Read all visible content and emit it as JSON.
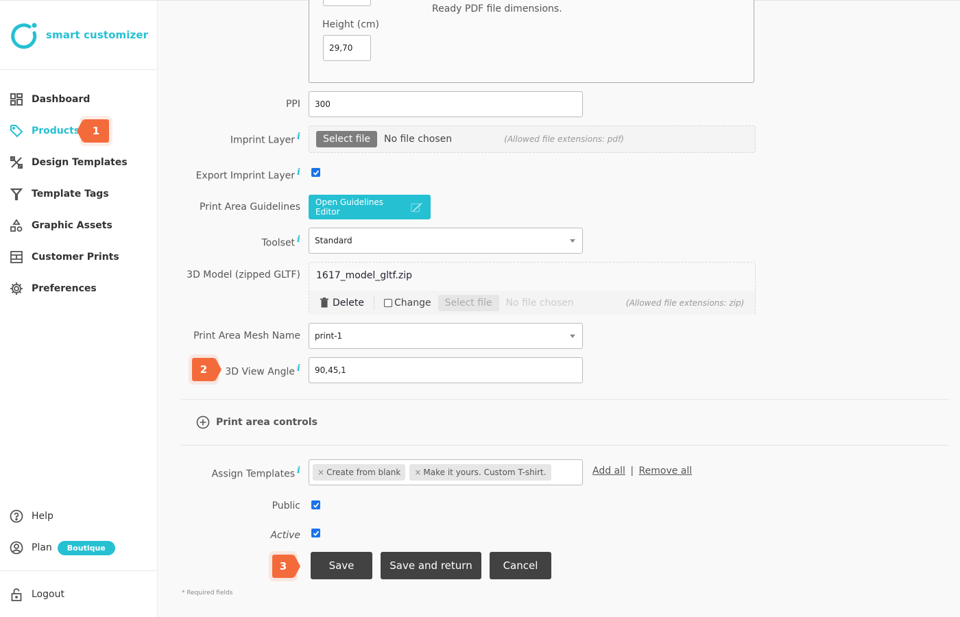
{
  "brand": {
    "name": "smart customizer",
    "accent": "#26c0d3",
    "step_badge_color": "#f46b3b"
  },
  "sidebar": {
    "items": [
      {
        "label": "Dashboard",
        "icon": "dashboard-icon",
        "active": false
      },
      {
        "label": "Products",
        "icon": "tag-icon",
        "active": true,
        "step": "1"
      },
      {
        "label": "Design Templates",
        "icon": "design-tools-icon",
        "active": false
      },
      {
        "label": "Template Tags",
        "icon": "filter-icon",
        "active": false
      },
      {
        "label": "Graphic Assets",
        "icon": "shapes-icon",
        "active": false
      },
      {
        "label": "Customer Prints",
        "icon": "prints-icon",
        "active": false
      },
      {
        "label": "Preferences",
        "icon": "gear-icon",
        "active": false
      }
    ],
    "bottom": {
      "help": "Help",
      "plan": "Plan",
      "plan_badge": "Boutique",
      "logout": "Logout"
    }
  },
  "form": {
    "dimensions": {
      "note": "Ready PDF file dimensions.",
      "height_label": "Height (cm)",
      "height_value": "29,70"
    },
    "ppi": {
      "label": "PPI",
      "value": "300"
    },
    "imprint_layer": {
      "label": "Imprint Layer",
      "button": "Select file",
      "status": "No file chosen",
      "hint": "(Allowed file extensions: pdf)"
    },
    "export_imprint_layer": {
      "label": "Export Imprint Layer",
      "checked": true
    },
    "print_area_guidelines": {
      "label": "Print Area Guidelines",
      "button": "Open Guidelines Editor"
    },
    "toolset": {
      "label": "Toolset",
      "value": "Standard"
    },
    "model_3d": {
      "label": "3D Model (zipped GLTF)",
      "filename": "1617_model_gltf.zip",
      "delete": "Delete",
      "change": "Change",
      "change_checked": false,
      "button": "Select file",
      "status": "No file chosen",
      "hint": "(Allowed file extensions: zip)"
    },
    "mesh_name": {
      "label": "Print Area Mesh Name",
      "value": "print-1"
    },
    "view_angle": {
      "label": "3D View Angle",
      "value": "90,45,1",
      "step": "2"
    },
    "print_area_controls": "Print area controls",
    "assign_templates": {
      "label": "Assign Templates",
      "tags": [
        "Create from blank",
        "Make it yours. Custom T-shirt."
      ],
      "add_all": "Add all",
      "separator": "|",
      "remove_all": "Remove all"
    },
    "public": {
      "label": "Public",
      "checked": true
    },
    "active": {
      "label": "Active",
      "checked": true
    },
    "actions": {
      "step": "3",
      "save": "Save",
      "save_return": "Save and return",
      "cancel": "Cancel"
    },
    "required_note": "* Required fields"
  }
}
